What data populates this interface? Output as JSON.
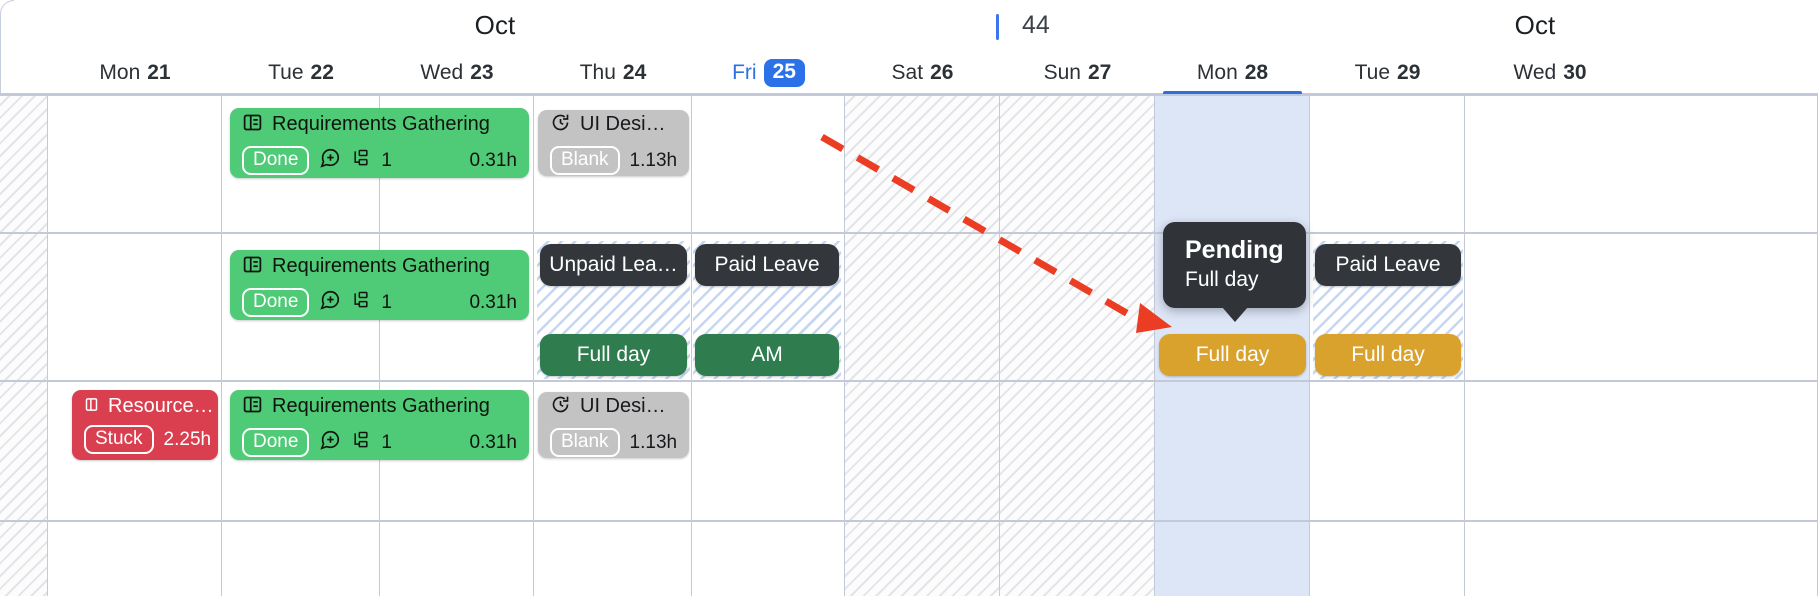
{
  "header": {
    "month_left": "Oct",
    "month_right": "Oct",
    "week_number": "44",
    "days": [
      {
        "dow": "Mon",
        "num": "21",
        "today": false,
        "selected": false
      },
      {
        "dow": "Tue",
        "num": "22",
        "today": false,
        "selected": false
      },
      {
        "dow": "Wed",
        "num": "23",
        "today": false,
        "selected": false
      },
      {
        "dow": "Thu",
        "num": "24",
        "today": false,
        "selected": false
      },
      {
        "dow": "Fri",
        "num": "25",
        "today": true,
        "selected": false
      },
      {
        "dow": "Sat",
        "num": "26",
        "today": false,
        "selected": false
      },
      {
        "dow": "Sun",
        "num": "27",
        "today": false,
        "selected": false
      },
      {
        "dow": "Mon",
        "num": "28",
        "today": false,
        "selected": true
      },
      {
        "dow": "Tue",
        "num": "29",
        "today": false,
        "selected": false
      },
      {
        "dow": "Wed",
        "num": "30",
        "today": false,
        "selected": false
      }
    ]
  },
  "tasks": {
    "requirements": {
      "title": "Requirements Gathering",
      "status": "Done",
      "subtask_count": "1",
      "hours": "0.31h",
      "icon": "board-icon",
      "comment_icon": "comment-plus-icon",
      "subtask_icon": "subtask-tree-icon"
    },
    "ui_design": {
      "title": "UI Desi…",
      "status": "Blank",
      "hours": "1.13h",
      "icon": "timer-icon"
    },
    "resource": {
      "title": "Resource…",
      "status": "Stuck",
      "hours": "2.25h",
      "icon": "board-small-icon"
    }
  },
  "leaves": {
    "unpaid": {
      "label": "Unpaid Lea…",
      "duration": "Full day"
    },
    "paid_fri": {
      "label": "Paid Leave",
      "duration": "AM"
    },
    "pending_mon": {
      "duration": "Full day"
    },
    "paid_tue": {
      "label": "Paid Leave",
      "duration": "Full day"
    }
  },
  "tooltip": {
    "title": "Pending",
    "subtitle": "Full day"
  },
  "colors": {
    "today_badge": "#2b72e8",
    "selected_underline": "#2d6fe0",
    "task_done": "#4fca76",
    "task_blank": "#c3c3c3",
    "task_stuck": "#d93f4f",
    "leave_dark": "#33373c",
    "leave_green": "#2f7d4f",
    "leave_amber": "#d9a22c",
    "drag_arrow": "#ea3d23"
  }
}
